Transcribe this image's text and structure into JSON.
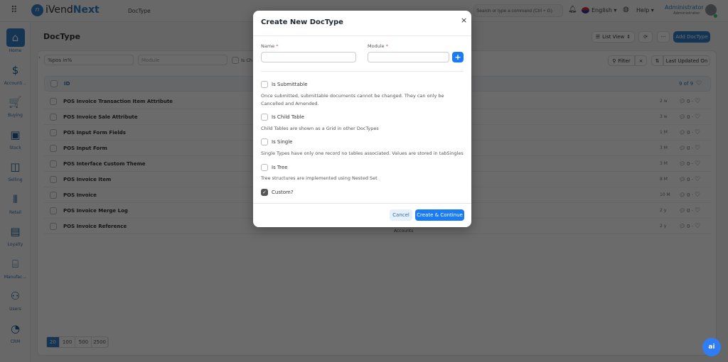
{
  "topbar": {
    "brand_prefix": "iVend",
    "brand_suffix": "Next",
    "breadcrumb": "DocType",
    "search_placeholder": "Search or type a command (Ctrl + G)",
    "language": "English",
    "help": "Help",
    "user_name": "Administrator",
    "user_role": "Administrator"
  },
  "sidebar": {
    "items": [
      {
        "label": "Home",
        "icon": "home-icon",
        "glyph": "⌂"
      },
      {
        "label": "Accounti...",
        "icon": "dollar-icon",
        "glyph": "$"
      },
      {
        "label": "Buying",
        "icon": "cart-icon",
        "glyph": "🛒"
      },
      {
        "label": "Stock",
        "icon": "box-icon",
        "glyph": "▣"
      },
      {
        "label": "Selling",
        "icon": "bag-icon",
        "glyph": "◫"
      },
      {
        "label": "Retail",
        "icon": "barcode-icon",
        "glyph": "⦀"
      },
      {
        "label": "Loyalty",
        "icon": "id-card-icon",
        "glyph": "▤"
      },
      {
        "label": "Manufac...",
        "icon": "factory-icon",
        "glyph": "⌸"
      },
      {
        "label": "Users",
        "icon": "users-icon",
        "glyph": "⚇"
      },
      {
        "label": "CRM",
        "icon": "pie-chart-icon",
        "glyph": "◔"
      }
    ]
  },
  "page": {
    "title": "DocType",
    "list_view": "List View",
    "add_button": "Add DocType",
    "filter_id": "%pos in%",
    "filter_module_placeholder": "Module",
    "filter_checkbox_label": "Is Ch",
    "filter_button": "Filter",
    "sort_label": "Last Updated On",
    "column_id": "ID",
    "count": "9 of 9",
    "rows": [
      {
        "name": "POS Invoice Transaction Item Attribute",
        "time": "2 w",
        "comments": "0"
      },
      {
        "name": "POS Invoice Sale Attribute",
        "time": "3 w",
        "comments": "0"
      },
      {
        "name": "POS Input Form Fields",
        "time": "1 M",
        "comments": "0"
      },
      {
        "name": "POS Input Form",
        "time": "3 M",
        "comments": "0"
      },
      {
        "name": "POS Interface Custom Theme",
        "time": "3 M",
        "comments": "0"
      },
      {
        "name": "POS Invoice Item",
        "time": "8 M",
        "comments": "0"
      },
      {
        "name": "POS Invoice",
        "time": "10 M",
        "comments": "0"
      },
      {
        "name": "POS Invoice Merge Log",
        "time": "2 y",
        "comments": "0"
      },
      {
        "name": "POS Invoice Reference",
        "time": "2 y",
        "comments": "0",
        "module": "Accounts"
      }
    ],
    "page_sizes": [
      "20",
      "100",
      "500",
      "2500"
    ],
    "selected_page_size": "20"
  },
  "modal": {
    "title": "Create New DocType",
    "name_label": "Name",
    "module_label": "Module",
    "name_value": "",
    "module_value": "",
    "options": [
      {
        "label": "Is Submittable",
        "checked": false,
        "desc": "Once submitted, submittable documents cannot be changed. They can only be Cancelled and Amended."
      },
      {
        "label": "Is Child Table",
        "checked": false,
        "desc": "Child Tables are shown as a Grid in other DocTypes"
      },
      {
        "label": "Is Single",
        "checked": false,
        "desc": "Single Types have only one record no tables associated. Values are stored in tabSingles"
      },
      {
        "label": "Is Tree",
        "checked": false,
        "desc": "Tree structures are implemented using Nested Set"
      },
      {
        "label": "Custom?",
        "checked": true,
        "desc": ""
      }
    ],
    "cancel": "Cancel",
    "submit": "Create & Continue"
  },
  "ai_button": "ai",
  "colors": {
    "primary": "#1a7cf5",
    "brand": "#2f80c9"
  }
}
